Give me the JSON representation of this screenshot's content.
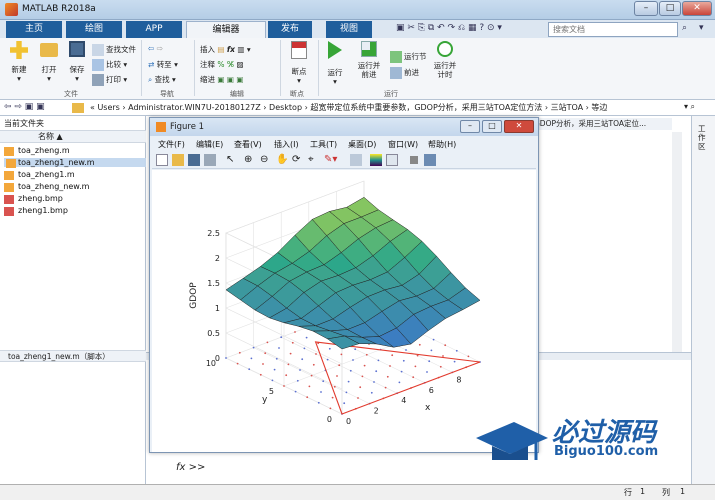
{
  "window": {
    "title": "MATLAB R2018a"
  },
  "tabs": [
    "主页",
    "绘图",
    "APP",
    "编辑器",
    "发布",
    "视图"
  ],
  "search_placeholder": "搜索文档",
  "ribbon": {
    "new": "新建",
    "open": "打开",
    "save": "保存",
    "find_files": "查找文件",
    "compare": "比较",
    "print": "打印",
    "goto": "转至",
    "find": "查找",
    "insert": "插入",
    "comment": "注释",
    "indent": "缩进",
    "breakpoints": "断点",
    "run": "运行",
    "run_advance": "运行并\n前进",
    "run_section": "运行节",
    "advance": "前进",
    "run_time": "运行并\n计时",
    "group_file": "文件",
    "group_nav": "导航",
    "group_edit": "编辑",
    "group_bp": "断点",
    "group_run": "运行"
  },
  "address": {
    "path": "«  Users  ›  Administrator.WIN7U-20180127Z  ›  Desktop  ›  超宽带定位系统中重要参数，GDOP分析，采用三站TOA定位方法  ›  三站TOA  ›  等边"
  },
  "left_panel": {
    "title": "当前文件夹",
    "column": "名称 ▲",
    "files": [
      "toa_zheng.m",
      "toa_zheng1_new.m",
      "toa_zheng1.m",
      "toa_zheng_new.m",
      "zheng.bmp",
      "zheng1.bmp"
    ],
    "detail": "toa_zheng1_new.m（脚本）"
  },
  "editor_tab": "GDOP分析，采用三站TOA定位...",
  "right_label": "工作区",
  "figure": {
    "title": "Figure 1",
    "menu": [
      "文件(F)",
      "编辑(E)",
      "查看(V)",
      "插入(I)",
      "工具(T)",
      "桌面(D)",
      "窗口(W)",
      "帮助(H)"
    ]
  },
  "chart_data": {
    "type": "surface",
    "zlabel": "GDOP",
    "xlabel": "x",
    "ylabel": "y",
    "zlim": [
      0,
      2.5
    ],
    "xlim": [
      0,
      10
    ],
    "ylim": [
      0,
      10
    ],
    "z_ticks": [
      "0",
      "0.5",
      "1",
      "1.5",
      "2",
      "2.5"
    ],
    "x_ticks": [
      "0",
      "2",
      "4",
      "6",
      "8"
    ],
    "y_ticks": [
      "0",
      "5",
      "10"
    ],
    "grid": "on",
    "x": [
      0,
      1.25,
      2.5,
      3.75,
      5,
      6.25,
      7.5,
      8.75,
      10
    ],
    "y": [
      0,
      1.25,
      2.5,
      3.75,
      5,
      6.25,
      7.5,
      8.75,
      10
    ],
    "z_description_row_y0": [
      1.3,
      1.2,
      1.1,
      1.0,
      0.95,
      1.0,
      1.05,
      1.15,
      1.3
    ],
    "z_description_row_y10": [
      1.3,
      1.4,
      1.6,
      1.8,
      1.95,
      2.05,
      2.1,
      2.15,
      2.25
    ],
    "triangle_stations": [
      [
        0,
        0
      ],
      [
        10,
        0
      ],
      [
        5,
        8.66
      ]
    ]
  },
  "cmd": {
    "prompt": "fx >>"
  },
  "status": {
    "row_label": "行",
    "row": "1",
    "col_label": "列",
    "col": "1"
  },
  "watermark": {
    "cn": "必过源码",
    "en": "Biguo100.com"
  }
}
